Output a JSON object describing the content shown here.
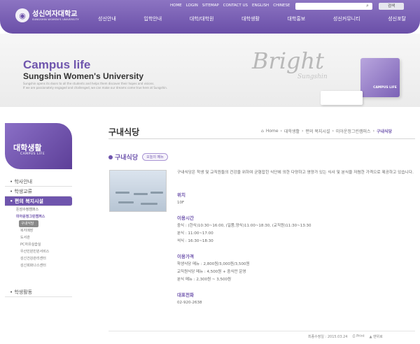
{
  "header": {
    "logo_ko": "성신여자대학교",
    "logo_en": "SUNGSHIN WOMEN'S UNIVERSITY",
    "utility": [
      "HOME",
      "LOGIN",
      "SITEMAP",
      "CONTACT US",
      "ENGLISH",
      "CHINESE"
    ],
    "search_button": "검색",
    "gnb": [
      "성신안내",
      "입학안내",
      "대학/대학원",
      "대학생활",
      "대학홍보",
      "성신커뮤니티",
      "성신포탈"
    ]
  },
  "banner": {
    "title": "Campus life",
    "subtitle": "Sungshin Women's University",
    "tagline_1": "Sungshin opens its doors to all the students and helps them discover their hopes and visions.",
    "tagline_2": "If we are passionately engaged and challenged, we can make our dreams come true here at Sungshin.",
    "deco_script": "Bright",
    "deco_sub": "Sungshin",
    "cube_label": "CAMPUS LIFE"
  },
  "sidebar": {
    "title_ko": "대학생활",
    "title_en": "CAMPUS LIFE",
    "items": [
      {
        "label": "학사안내",
        "level": 1
      },
      {
        "label": "학생교류",
        "level": 1
      },
      {
        "label": "편의 복지시설",
        "level": 1,
        "active": true
      },
      {
        "label": "돈암수정캠퍼스",
        "level": 2
      },
      {
        "label": "미아운정그린캠퍼스",
        "level": 2,
        "selected": true
      },
      {
        "label": "구내식당",
        "level": 3,
        "current": true
      },
      {
        "label": "복지매장",
        "level": 3
      },
      {
        "label": "도서관",
        "level": 3
      },
      {
        "label": "PC자유실습실",
        "level": 3
      },
      {
        "label": "우산민원민원서비스",
        "level": 3
      },
      {
        "label": "성신건강관리센터",
        "level": 3
      },
      {
        "label": "성신회화나스센터",
        "level": 3
      },
      {
        "label": "학생활동",
        "level": 1
      }
    ]
  },
  "content": {
    "page_title": "구내식당",
    "breadcrumb": [
      "Home",
      "대학생활",
      "편의 복지시설",
      "미아운정그린캠퍼스",
      "구내식당"
    ],
    "sub_title": "구내식당",
    "menu_button": "오늘의 메뉴",
    "intro": "구내식당은 학생 및 교직원들의 건강을 위하여 균형잡힌 식단에 의한 다양하고 영양가 있는 식사 및 분식을 저렴한 가격으로 제공하고 있습니다.",
    "sections": [
      {
        "heading": "위치",
        "lines": [
          "10F"
        ]
      },
      {
        "heading": "이용시간",
        "lines": [
          "중식 : (한식)10:30~16:00, (일품,양식)11:00~18:30, (교직원)11:30~13:30",
          "분식 : 11:00~17:00",
          "석식 : 16:30~18:30"
        ]
      },
      {
        "heading": "이용가격",
        "lines": [
          "학생식당 메뉴 : 2,800원/3,000원/3,500원",
          "교직원식당 메뉴 : 4,500원 + 중식만 운영",
          "분식 메뉴 : 2,300원 ~ 3,500원"
        ]
      },
      {
        "heading": "대표전화",
        "lines": [
          "02-920-2638"
        ]
      }
    ]
  },
  "footer": {
    "updated": "최종수정일 : 2015.03.24",
    "print": "Print",
    "top": "맨위로"
  }
}
